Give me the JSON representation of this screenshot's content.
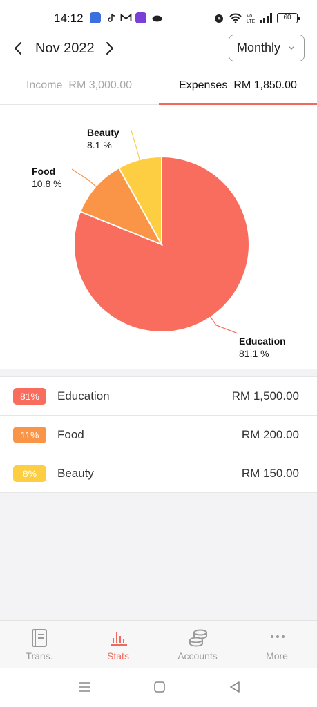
{
  "status_bar": {
    "time": "14:12",
    "battery": "60"
  },
  "header": {
    "month": "Nov 2022",
    "period": "Monthly"
  },
  "tabs": [
    {
      "label": "Income",
      "amount": "RM 3,000.00",
      "active": false
    },
    {
      "label": "Expenses",
      "amount": "RM 1,850.00",
      "active": true
    }
  ],
  "colors": {
    "accent": "#ef6a5c",
    "education": "#f86d5e",
    "food": "#fa9548",
    "beauty": "#fdce41"
  },
  "chart_data": {
    "type": "pie",
    "slices": [
      {
        "label": "Education",
        "value": 81.1,
        "display": "81.1 %"
      },
      {
        "label": "Food",
        "value": 10.8,
        "display": "10.8 %"
      },
      {
        "label": "Beauty",
        "value": 8.1,
        "display": "8.1 %"
      }
    ]
  },
  "categories": [
    {
      "percent": "81%",
      "name": "Education",
      "amount": "RM 1,500.00"
    },
    {
      "percent": "11%",
      "name": "Food",
      "amount": "RM 200.00"
    },
    {
      "percent": "8%",
      "name": "Beauty",
      "amount": "RM 150.00"
    }
  ],
  "bottom_nav": [
    {
      "label": "Trans.",
      "icon": "book-icon"
    },
    {
      "label": "Stats",
      "icon": "bar-chart-icon"
    },
    {
      "label": "Accounts",
      "icon": "coins-icon"
    },
    {
      "label": "More",
      "icon": "more-dots-icon"
    }
  ]
}
